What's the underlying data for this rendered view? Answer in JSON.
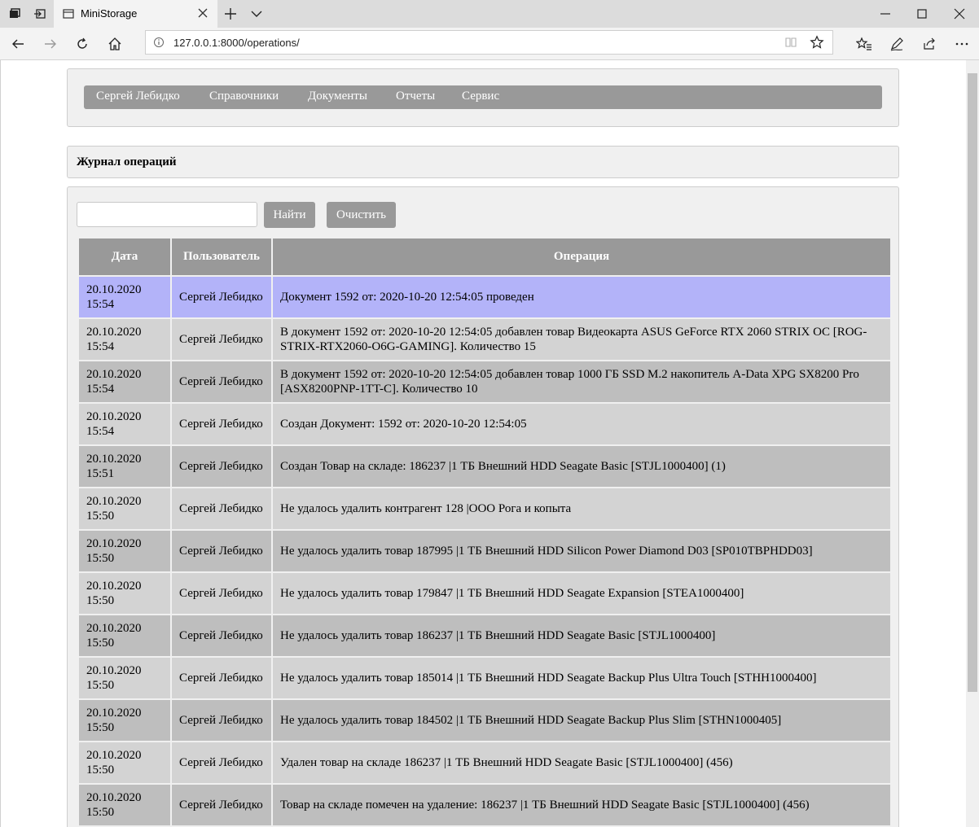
{
  "browser": {
    "tab_title": "MiniStorage",
    "url": "127.0.0.1:8000/operations/"
  },
  "nav": {
    "items": [
      "Сергей Лебидко",
      "Справочники",
      "Документы",
      "Отчеты",
      "Сервис"
    ]
  },
  "page": {
    "heading": "Журнал операций"
  },
  "search": {
    "value": "",
    "find_label": "Найти",
    "clear_label": "Очистить"
  },
  "table": {
    "headers": [
      "Дата",
      "Пользователь",
      "Операция"
    ],
    "rows": [
      {
        "date": "20.10.2020 15:54",
        "user": "Сергей Лебидко",
        "op": "Документ 1592 от: 2020-10-20 12:54:05 проведен",
        "style": "sel"
      },
      {
        "date": "20.10.2020 15:54",
        "user": "Сергей Лебидко",
        "op": "В документ 1592 от: 2020-10-20 12:54:05 добавлен товар Видеокарта ASUS GeForce RTX 2060 STRIX OC [ROG-STRIX-RTX2060-O6G-GAMING]. Количество 15",
        "style": "light"
      },
      {
        "date": "20.10.2020 15:54",
        "user": "Сергей Лебидко",
        "op": "В документ 1592 от: 2020-10-20 12:54:05 добавлен товар 1000 ГБ SSD M.2 накопитель A-Data XPG SX8200 Pro [ASX8200PNP-1TT-C]. Количество 10",
        "style": "dark"
      },
      {
        "date": "20.10.2020 15:54",
        "user": "Сергей Лебидко",
        "op": "Создан Документ: 1592 от: 2020-10-20 12:54:05",
        "style": "light"
      },
      {
        "date": "20.10.2020 15:51",
        "user": "Сергей Лебидко",
        "op": "Создан Товар на складе: 186237 |1 ТБ Внешний HDD Seagate Basic [STJL1000400] (1)",
        "style": "dark"
      },
      {
        "date": "20.10.2020 15:50",
        "user": "Сергей Лебидко",
        "op": "Не удалось удалить контрагент 128 |ООО Рога и копыта",
        "style": "light"
      },
      {
        "date": "20.10.2020 15:50",
        "user": "Сергей Лебидко",
        "op": "Не удалось удалить товар 187995 |1 ТБ Внешний HDD Silicon Power Diamond D03 [SP010TBPHDD03]",
        "style": "dark"
      },
      {
        "date": "20.10.2020 15:50",
        "user": "Сергей Лебидко",
        "op": "Не удалось удалить товар 179847 |1 ТБ Внешний HDD Seagate Expansion [STEA1000400]",
        "style": "light"
      },
      {
        "date": "20.10.2020 15:50",
        "user": "Сергей Лебидко",
        "op": "Не удалось удалить товар 186237 |1 ТБ Внешний HDD Seagate Basic [STJL1000400]",
        "style": "dark"
      },
      {
        "date": "20.10.2020 15:50",
        "user": "Сергей Лебидко",
        "op": "Не удалось удалить товар 185014 |1 ТБ Внешний HDD Seagate Backup Plus Ultra Touch [STHH1000400]",
        "style": "light"
      },
      {
        "date": "20.10.2020 15:50",
        "user": "Сергей Лебидко",
        "op": "Не удалось удалить товар 184502 |1 ТБ Внешний HDD Seagate Backup Plus Slim [STHN1000405]",
        "style": "dark"
      },
      {
        "date": "20.10.2020 15:50",
        "user": "Сергей Лебидко",
        "op": "Удален товар на складе 186237 |1 ТБ Внешний HDD Seagate Basic [STJL1000400] (456)",
        "style": "light"
      },
      {
        "date": "20.10.2020 15:50",
        "user": "Сергей Лебидко",
        "op": "Товар на складе помечен на удаление: 186237 |1 ТБ Внешний HDD Seagate Basic [STJL1000400] (456)",
        "style": "dark"
      }
    ]
  },
  "icons": {
    "tab_actions": "tab-actions-icon",
    "set_aside": "set-aside-tabs-icon",
    "page": "page-icon",
    "close": "close-icon",
    "new_tab": "plus-icon",
    "tab_list": "chevron-down-icon",
    "minimize": "minimize-icon",
    "maximize": "maximize-icon",
    "window_close": "close-icon",
    "back": "back-arrow-icon",
    "forward": "forward-arrow-icon",
    "refresh": "refresh-icon",
    "home": "home-icon",
    "info": "info-icon",
    "reading_view": "reading-view-icon",
    "favorite": "star-icon",
    "favorites": "favorites-icon",
    "notes": "pen-icon",
    "share": "share-icon",
    "more": "more-icon"
  },
  "colors": {
    "menu_bg": "#999999",
    "panel_bg": "#f0f0f0",
    "row_selected": "#b3b3f9",
    "row_light": "#d3d3d3",
    "row_dark": "#bebebe"
  }
}
